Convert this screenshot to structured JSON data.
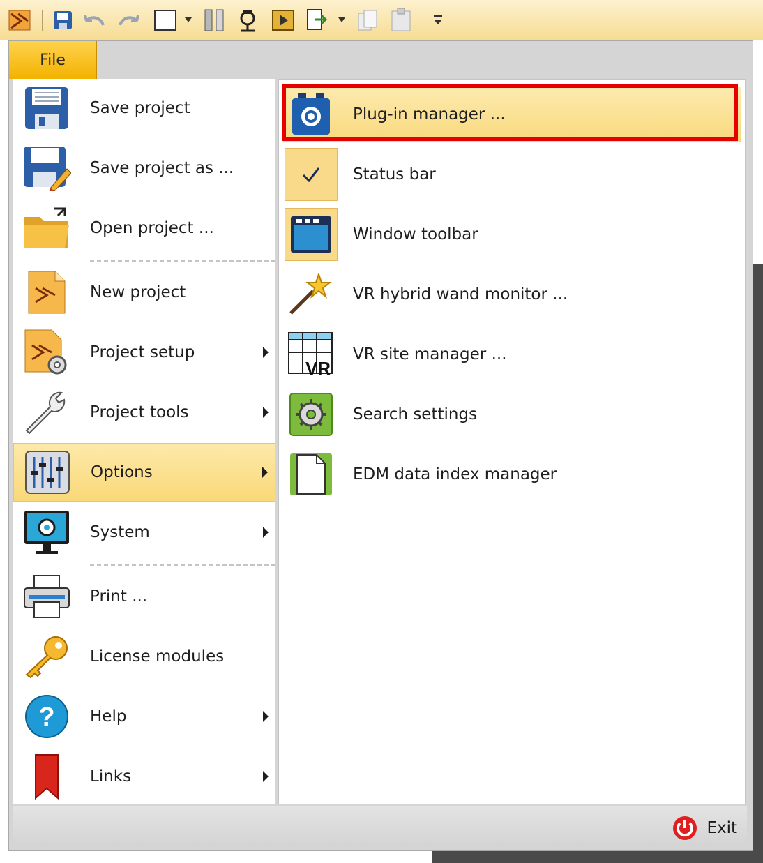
{
  "toolbar": {
    "icons": [
      "app-logo-icon",
      "save-icon",
      "undo-icon",
      "redo-icon",
      "new-window-icon",
      "dropdown-icon",
      "column-icon",
      "tool-icon",
      "play-icon",
      "export-icon",
      "copy-icon",
      "paste-icon",
      "customize-icon"
    ]
  },
  "file_tab": {
    "label": "File"
  },
  "left_menu": {
    "items": [
      {
        "label": "Save project",
        "has_submenu": false
      },
      {
        "label": "Save project as ...",
        "has_submenu": false
      },
      {
        "label": "Open project ...",
        "has_submenu": false
      },
      {
        "label": "New project",
        "has_submenu": false
      },
      {
        "label": "Project setup",
        "has_submenu": true
      },
      {
        "label": "Project tools",
        "has_submenu": true
      },
      {
        "label": "Options",
        "has_submenu": true,
        "active": true
      },
      {
        "label": "System",
        "has_submenu": true
      },
      {
        "label": "Print ...",
        "has_submenu": false
      },
      {
        "label": "License modules",
        "has_submenu": false
      },
      {
        "label": "Help",
        "has_submenu": true
      },
      {
        "label": "Links",
        "has_submenu": true
      }
    ]
  },
  "options_submenu": {
    "items": [
      {
        "label": "Plug-in manager ...",
        "highlighted": true
      },
      {
        "label": "Status bar",
        "checked": true
      },
      {
        "label": "Window toolbar"
      },
      {
        "label": "VR hybrid wand monitor ..."
      },
      {
        "label": "VR site manager ..."
      },
      {
        "label": "Search settings"
      },
      {
        "label": "EDM data index manager"
      }
    ],
    "vr_icon_text": "VR"
  },
  "footer": {
    "exit_label": "Exit"
  },
  "colors": {
    "accent": "#f3b200",
    "highlight_border": "#e60000",
    "active_bg": "#f9d877"
  }
}
